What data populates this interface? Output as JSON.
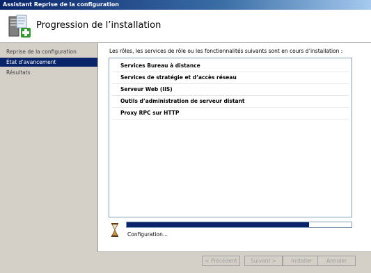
{
  "window": {
    "title": "Assistant Reprise de la configuration"
  },
  "header": {
    "title": "Progression de l’installation",
    "icon": "server-roles-install-icon"
  },
  "nav": {
    "items": [
      {
        "label": "Reprise de la configuration",
        "active": false
      },
      {
        "label": "État d’avancement",
        "active": true
      },
      {
        "label": "Résultats",
        "active": false
      }
    ]
  },
  "main": {
    "intro": "Les rôles, les services de rôle ou les fonctionnalités suivants sont en cours d’installation :",
    "items": [
      "Services Bureau à distance",
      "Services de stratégie et d’accès réseau",
      "Serveur Web (IIS)",
      "Outils d’administration de serveur distant",
      "Proxy RPC sur HTTP"
    ],
    "progress": {
      "fraction": 0.81,
      "label": "Configuration..."
    }
  },
  "footer": {
    "previous_label": "< Précédent",
    "next_label": "Suivant >",
    "install_label": "Installer",
    "cancel_label": "Annuler"
  },
  "colors": {
    "accent": "#0a246a",
    "window_bg": "#d4d0c8"
  }
}
